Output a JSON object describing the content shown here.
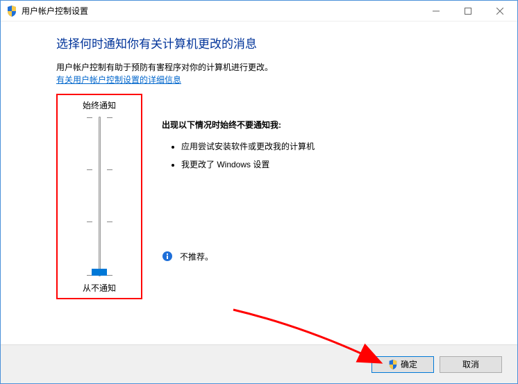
{
  "titlebar": {
    "title": "用户帐户控制设置"
  },
  "content": {
    "heading": "选择何时通知你有关计算机更改的消息",
    "description": "用户帐户控制有助于预防有害程序对你的计算机进行更改。",
    "link": "有关用户帐户控制设置的详细信息"
  },
  "slider": {
    "topLabel": "始终通知",
    "bottomLabel": "从不通知",
    "level": 0,
    "levels": 4
  },
  "setting": {
    "title": "出现以下情况时始终不要通知我:",
    "items": [
      "应用尝试安装软件或更改我的计算机",
      "我更改了 Windows 设置"
    ],
    "recommend": "不推荐。"
  },
  "footer": {
    "ok": "确定",
    "cancel": "取消"
  }
}
